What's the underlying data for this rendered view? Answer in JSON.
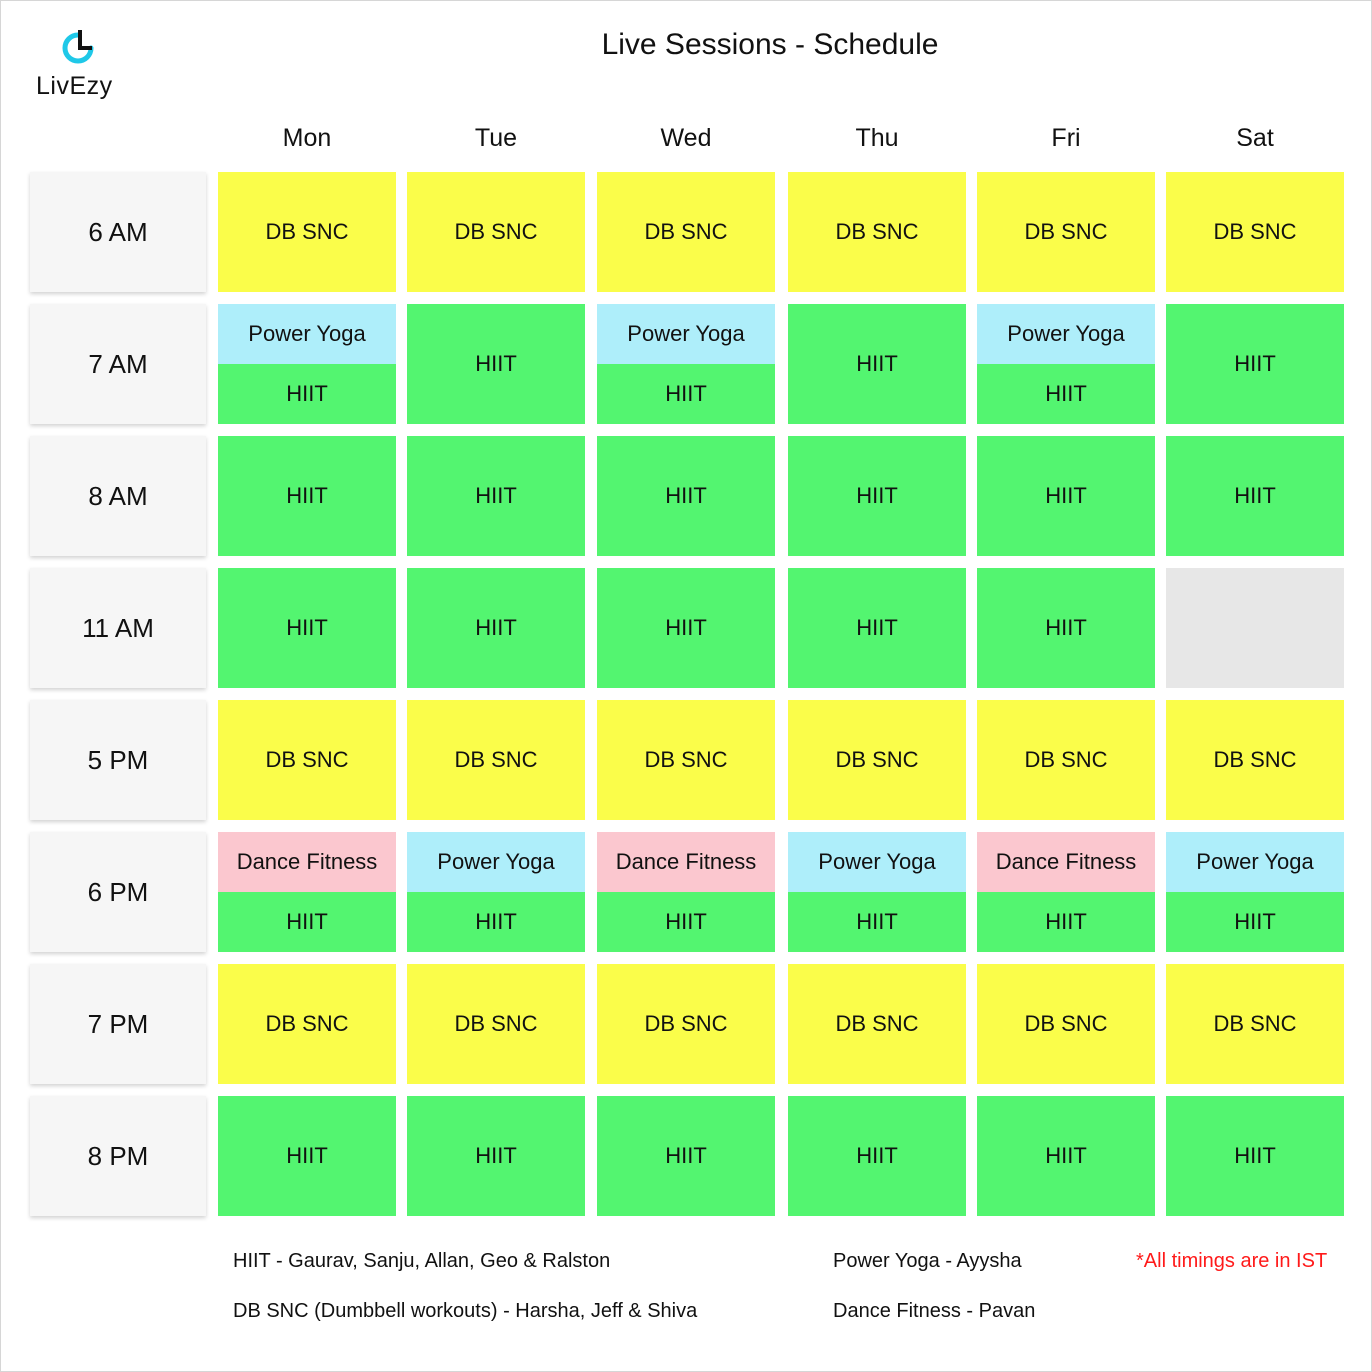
{
  "brand": {
    "name": "LivEzy",
    "accent_color": "#1fc8e8"
  },
  "title": "Live Sessions - Schedule",
  "days": [
    "Mon",
    "Tue",
    "Wed",
    "Thu",
    "Fri",
    "Sat"
  ],
  "times": [
    "6 AM",
    "7 AM",
    "8 AM",
    "11 AM",
    "5 PM",
    "6 PM",
    "7 PM",
    "8 PM"
  ],
  "sessions": [
    [
      [
        "DB SNC"
      ],
      [
        "DB SNC"
      ],
      [
        "DB SNC"
      ],
      [
        "DB SNC"
      ],
      [
        "DB SNC"
      ],
      [
        "DB SNC"
      ]
    ],
    [
      [
        "Power Yoga",
        "HIIT"
      ],
      [
        "HIIT"
      ],
      [
        "Power Yoga",
        "HIIT"
      ],
      [
        "HIIT"
      ],
      [
        "Power Yoga",
        "HIIT"
      ],
      [
        "HIIT"
      ]
    ],
    [
      [
        "HIIT"
      ],
      [
        "HIIT"
      ],
      [
        "HIIT"
      ],
      [
        "HIIT"
      ],
      [
        "HIIT"
      ],
      [
        "HIIT"
      ]
    ],
    [
      [
        "HIIT"
      ],
      [
        "HIIT"
      ],
      [
        "HIIT"
      ],
      [
        "HIIT"
      ],
      [
        "HIIT"
      ],
      []
    ],
    [
      [
        "DB SNC"
      ],
      [
        "DB SNC"
      ],
      [
        "DB SNC"
      ],
      [
        "DB SNC"
      ],
      [
        "DB SNC"
      ],
      [
        "DB SNC"
      ]
    ],
    [
      [
        "Dance Fitness",
        "HIIT"
      ],
      [
        "Power Yoga",
        "HIIT"
      ],
      [
        "Dance Fitness",
        "HIIT"
      ],
      [
        "Power Yoga",
        "HIIT"
      ],
      [
        "Dance Fitness",
        "HIIT"
      ],
      [
        "Power Yoga",
        "HIIT"
      ]
    ],
    [
      [
        "DB SNC"
      ],
      [
        "DB SNC"
      ],
      [
        "DB SNC"
      ],
      [
        "DB SNC"
      ],
      [
        "DB SNC"
      ],
      [
        "DB SNC"
      ]
    ],
    [
      [
        "HIIT"
      ],
      [
        "HIIT"
      ],
      [
        "HIIT"
      ],
      [
        "HIIT"
      ],
      [
        "HIIT"
      ],
      [
        "HIIT"
      ]
    ]
  ],
  "session_colors": {
    "DB SNC": "#fafd4a",
    "HIIT": "#53f570",
    "Power Yoga": "#aeeefa",
    "Dance Fitness": "#fbc7cf",
    "empty": "#e7e7e7"
  },
  "legend": {
    "hiit": "HIIT - Gaurav, Sanju, Allan, Geo & Ralston",
    "dbsnc": "DB SNC (Dumbbell workouts) - Harsha, Jeff & Shiva",
    "yoga": "Power Yoga - Ayysha",
    "dance": "Dance Fitness - Pavan",
    "note": "*All timings are in IST",
    "note_color": "#ff1a1a"
  }
}
